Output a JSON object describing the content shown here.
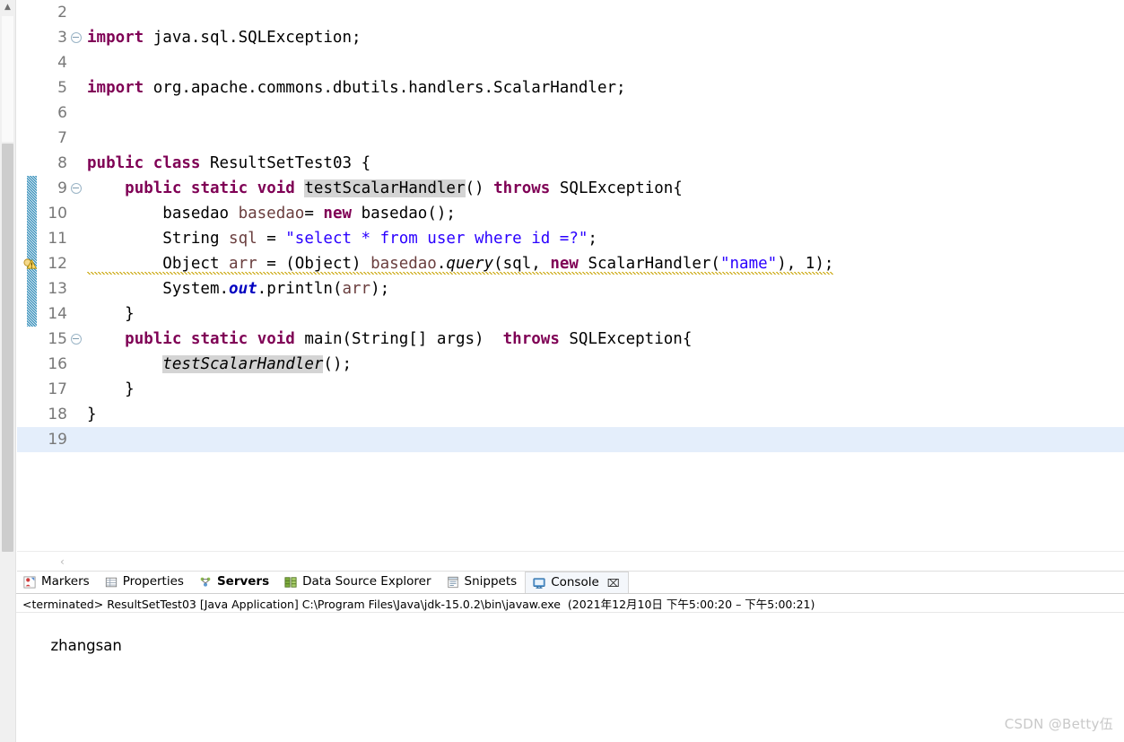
{
  "ide": {
    "name": "Eclipse IDE",
    "editor": {
      "file_class": "ResultSetTest03",
      "current_line": 19,
      "lines": [
        {
          "n": 2,
          "fold": false,
          "warn": false,
          "changed": false,
          "text": ""
        },
        {
          "n": 3,
          "fold": true,
          "warn": false,
          "changed": false,
          "text": "import java.sql.SQLException;"
        },
        {
          "n": 4,
          "fold": false,
          "warn": false,
          "changed": false,
          "text": ""
        },
        {
          "n": 5,
          "fold": false,
          "warn": false,
          "changed": false,
          "text": "import org.apache.commons.dbutils.handlers.ScalarHandler;"
        },
        {
          "n": 6,
          "fold": false,
          "warn": false,
          "changed": false,
          "text": ""
        },
        {
          "n": 7,
          "fold": false,
          "warn": false,
          "changed": false,
          "text": ""
        },
        {
          "n": 8,
          "fold": false,
          "warn": false,
          "changed": false,
          "text": "public class ResultSetTest03 {"
        },
        {
          "n": 9,
          "fold": true,
          "warn": false,
          "changed": true,
          "text": "    public static void testScalarHandler() throws SQLException{"
        },
        {
          "n": 10,
          "fold": false,
          "warn": false,
          "changed": true,
          "text": "        basedao basedao= new basedao();"
        },
        {
          "n": 11,
          "fold": false,
          "warn": false,
          "changed": true,
          "text": "        String sql = \"select * from user where id =?\";"
        },
        {
          "n": 12,
          "fold": false,
          "warn": true,
          "changed": true,
          "text": "        Object arr = (Object) basedao.query(sql, new ScalarHandler(\"name\"), 1);"
        },
        {
          "n": 13,
          "fold": false,
          "warn": false,
          "changed": true,
          "text": "        System.out.println(arr);"
        },
        {
          "n": 14,
          "fold": false,
          "warn": false,
          "changed": true,
          "text": "    }"
        },
        {
          "n": 15,
          "fold": true,
          "warn": false,
          "changed": false,
          "text": "    public static void main(String[] args)  throws SQLException{"
        },
        {
          "n": 16,
          "fold": false,
          "warn": false,
          "changed": false,
          "text": "        testScalarHandler();"
        },
        {
          "n": 17,
          "fold": false,
          "warn": false,
          "changed": false,
          "text": "    }"
        },
        {
          "n": 18,
          "fold": false,
          "warn": false,
          "changed": false,
          "text": "}"
        },
        {
          "n": 19,
          "fold": false,
          "warn": false,
          "changed": false,
          "text": ""
        }
      ],
      "hscroll_left_arrow": "‹"
    },
    "bottom_panel": {
      "tabs": [
        {
          "label": "Markers",
          "icon": "markers-icon",
          "active": false,
          "bold": false,
          "closable": false
        },
        {
          "label": "Properties",
          "icon": "properties-icon",
          "active": false,
          "bold": false,
          "closable": false
        },
        {
          "label": "Servers",
          "icon": "servers-icon",
          "active": false,
          "bold": true,
          "closable": false
        },
        {
          "label": "Data Source Explorer",
          "icon": "data-source-explorer-icon",
          "active": false,
          "bold": false,
          "closable": false
        },
        {
          "label": "Snippets",
          "icon": "snippets-icon",
          "active": false,
          "bold": false,
          "closable": false
        },
        {
          "label": "Console",
          "icon": "console-icon",
          "active": true,
          "bold": false,
          "closable": true
        }
      ],
      "close_glyph": "⌧",
      "console": {
        "status_line": "<terminated> ResultSetTest03 [Java Application] C:\\Program Files\\Java\\jdk-15.0.2\\bin\\javaw.exe  (2021年12月10日 下午5:00:20 – 下午5:00:21)",
        "output": "zhangsan"
      }
    },
    "watermark": "CSDN @Betty伍",
    "colors": {
      "keyword": "#7f0055",
      "string": "#2a00ff",
      "local_var": "#6a3e3e",
      "static_field": "#0000c0",
      "line_number": "#787878",
      "current_line_highlight": "#e4eefb",
      "occurrence_highlight": "#d4d4d4",
      "change_bar": "#2e8ab8",
      "warning_underline": "#c8a300"
    }
  }
}
